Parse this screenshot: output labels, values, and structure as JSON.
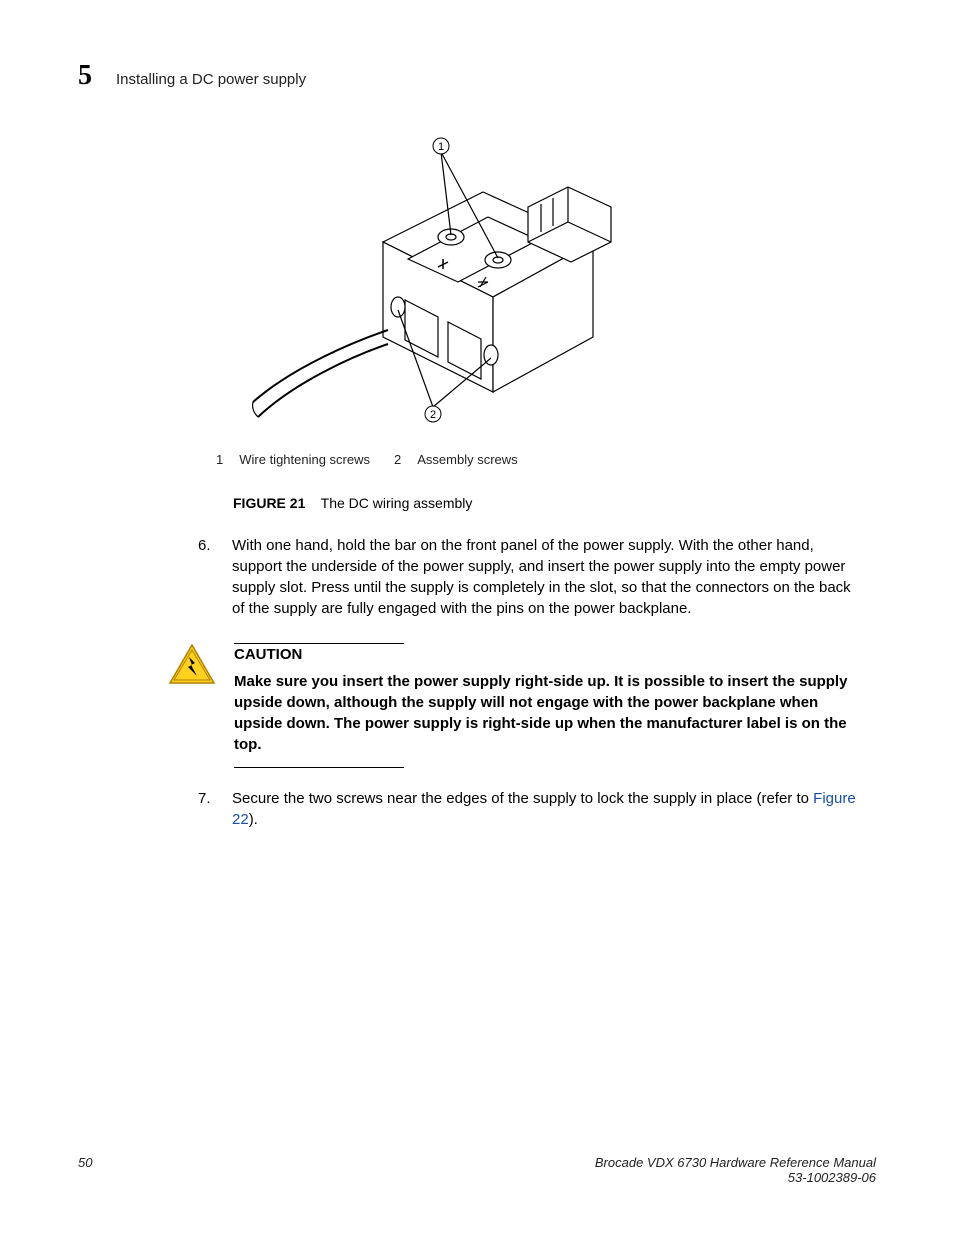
{
  "header": {
    "chapter_num": "5",
    "chapter_title": "Installing a DC power supply"
  },
  "figure": {
    "callout1": "1",
    "callout2": "2",
    "legend": [
      {
        "num": "1",
        "text": "Wire tightening screws"
      },
      {
        "num": "2",
        "text": "Assembly screws"
      }
    ],
    "caption_label": "FIGURE 21",
    "caption_text": "The DC wiring assembly"
  },
  "steps": {
    "s6": {
      "num": "6.",
      "text": "With one hand, hold the bar on the front panel of the power supply. With the other hand, support the underside of the power supply, and insert the power supply into the empty power supply slot. Press until the supply is completely in the slot, so that the connectors on the back of the supply are fully engaged with the pins on the power backplane."
    },
    "s7": {
      "num": "7.",
      "text_before": "Secure the two screws near the edges of the supply to lock the supply in place (refer to ",
      "link": "Figure 22",
      "text_after": ")."
    }
  },
  "caution": {
    "title": "CAUTION",
    "text": "Make sure you insert the power supply right-side up. It is possible to insert the supply upside down, although the supply will not engage with the power backplane when upside down. The power supply is right-side up when the manufacturer label is on the top."
  },
  "footer": {
    "page": "50",
    "manual": "Brocade VDX 6730 Hardware Reference Manual",
    "partnum": "53-1002389-06"
  }
}
